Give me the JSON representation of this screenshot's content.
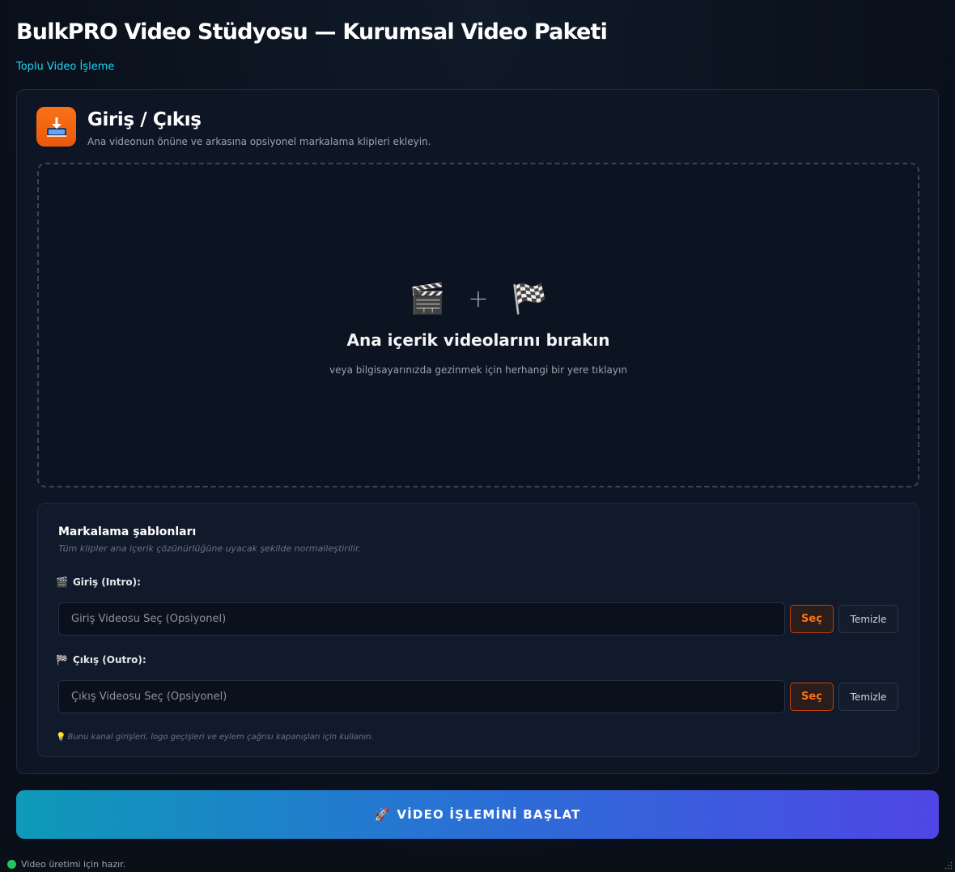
{
  "app": {
    "title": "BulkPRO Video Stüdyosu — Kurumsal Video Paketi",
    "subtitle": "Toplu Video İşleme"
  },
  "section": {
    "title": "Giriş / Çıkış",
    "description": "Ana videonun önüne ve arkasına opsiyonel markalama klipleri ekleyin.",
    "icon": "import-tray-icon"
  },
  "dropzone": {
    "icon_left": "🎬",
    "plus": "+",
    "icon_right": "🏁",
    "title": "Ana içerik videolarını bırakın",
    "hint": "veya bilgisayarınızda gezinmek için herhangi bir yere tıklayın"
  },
  "branding": {
    "title": "Markalama şablonları",
    "description": "Tüm klipler ana içerik çözünürlüğüne uyacak şekilde normalleştirilir.",
    "intro": {
      "icon": "🎬",
      "label": "Giriş (Intro):",
      "placeholder": "Giriş Videosu Seç (Opsiyonel)",
      "select_label": "Seç",
      "clear_label": "Temizle"
    },
    "outro": {
      "icon": "🏁",
      "label": "Çıkış (Outro):",
      "placeholder": "Çıkış Videosu Seç (Opsiyonel)",
      "select_label": "Seç",
      "clear_label": "Temizle"
    },
    "note_icon": "💡",
    "note": "Bunu kanal girişleri, logo geçişleri ve eylem çağrısı kapanışları için kullanın."
  },
  "start_button": {
    "icon": "🚀",
    "label": "VİDEO İŞLEMİNİ BAŞLAT"
  },
  "status": {
    "text": "Video üretimi için hazır.",
    "color": "#22c55e"
  },
  "colors": {
    "accent_orange": "#f97316",
    "accent_cyan": "#22d3ee",
    "gradient_start": "#0e9ab8",
    "gradient_end": "#4f46e5"
  }
}
